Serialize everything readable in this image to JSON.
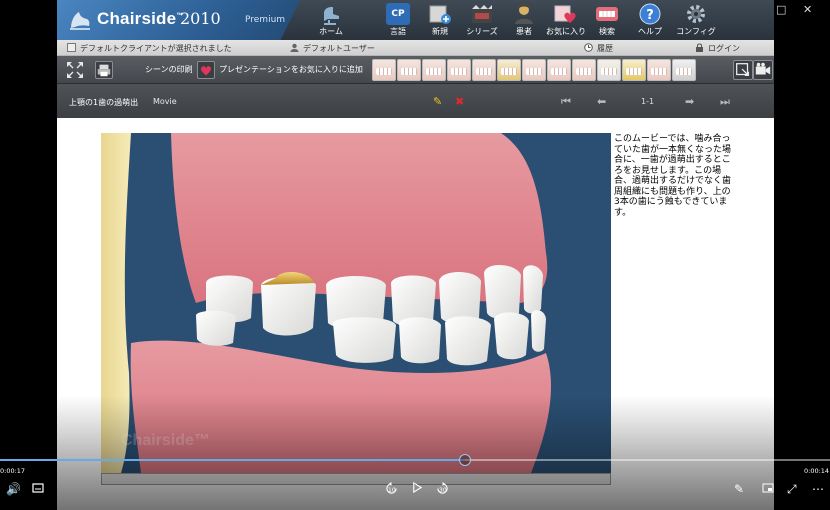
{
  "app": {
    "brand_name": "Chairside",
    "brand_tm": "™",
    "brand_year": "2010",
    "brand_edition": "Premium"
  },
  "toolbar": [
    {
      "label": "ホーム",
      "icon": "home-chair-icon",
      "color": "#7fa6c9"
    },
    {
      "label": "言語",
      "icon": "language-icon",
      "color": "#2e6db6"
    },
    {
      "label": "新規",
      "icon": "new-icon",
      "color": "#c9c9c9"
    },
    {
      "label": "シリーズ",
      "icon": "series-icon",
      "color": "#8a8a8a"
    },
    {
      "label": "患者",
      "icon": "patient-icon",
      "color": "#c9a54a"
    },
    {
      "label": "お気に入り",
      "icon": "favorites-icon",
      "color": "#e04d6a"
    },
    {
      "label": "検索",
      "icon": "search-teeth-icon",
      "color": "#e8e3d8"
    },
    {
      "label": "ヘルプ",
      "icon": "help-icon",
      "color": "#3d7fd6"
    },
    {
      "label": "コンフィグ",
      "icon": "config-gear-icon",
      "color": "#6d7a86"
    }
  ],
  "status": {
    "client": "デフォルトクライアントが選択されました",
    "user": "デフォルトユーザー",
    "history": "履歴",
    "login": "ログイン"
  },
  "presentation": {
    "print_scene": "シーンの印刷",
    "add_favorite": "プレゼンテーションをお気に入りに追加"
  },
  "title": {
    "text": "上顎の1歯の過萌出",
    "kind": "Movie",
    "page": "1-1"
  },
  "movie": {
    "watermark": "Chairside™"
  },
  "description": "このムービーでは、噛み合っていた歯が一本無くなった場合に、一歯が過萌出するところをお見せします。この場合、過萌出するだけでなく歯周組織にも問題も作り、上の3本の歯にう蝕もできています。",
  "player": {
    "elapsed": "0:00:17",
    "remaining": "0:00:14",
    "progress": 0.56,
    "skip_back": "10",
    "skip_forward": "30"
  },
  "colors": {
    "accent": "#6aa9e8",
    "gum": "#e58a93",
    "background_movie": "#2b4e6e"
  }
}
